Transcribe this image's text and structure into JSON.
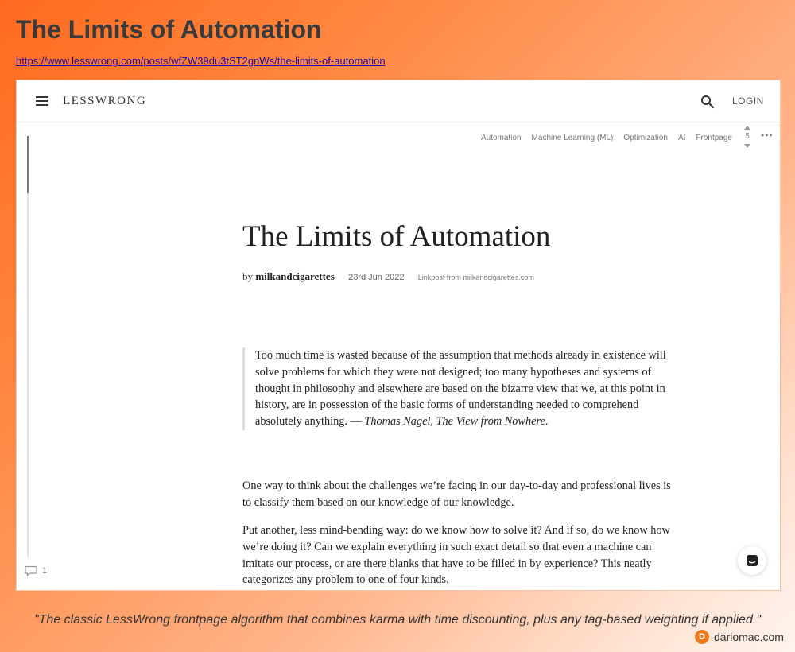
{
  "header": {
    "title": "The Limits of Automation",
    "url": "https://www.lesswrong.com/posts/wfZW39du3tST2gnWs/the-limits-of-automation"
  },
  "site": {
    "logo": "LESSWRONG",
    "login": "LOGIN",
    "icons": {
      "menu": "menu-icon",
      "search": "search-icon",
      "chat": "chat-icon",
      "comment": "comment-icon"
    }
  },
  "post": {
    "tags": [
      "Automation",
      "Machine Learning (ML)",
      "Optimization",
      "AI",
      "Frontpage"
    ],
    "karma": "5",
    "more": "•••",
    "title": "The Limits of Automation",
    "by": "by",
    "author": "milkandcigarettes",
    "date": "23rd Jun 2022",
    "linkpost": "Linkpost from milkandcigarettes.com",
    "quote_text": "Too much time is wasted because of the assumption that methods already in existence will solve problems for which they were not designed; too many hypotheses and systems of thought in philosophy and elsewhere are based on the bizarre view that we, at this point in history, are in possession of the basic forms of understanding needed to comprehend absolutely anything. — ",
    "quote_source": "Thomas Nagel, The View from Nowhere",
    "quote_end": ".",
    "paragraphs": [
      "One way to think about the challenges we’re facing in our day-to-day and professional lives is to classify them based on our knowledge of our knowledge.",
      "Put another, less mind-bending way: do we know how to solve it? And if so, do we know how we’re doing it? Can we explain everything in such exact detail so that even a machine can imitate our process, or are there blanks that have to be filled in by experience? This neatly categorizes any problem to one of four kinds."
    ],
    "comment_count": "1"
  },
  "footer": {
    "caption": "\"The classic LessWrong frontpage algorithm that combines karma with time discounting, plus any tag-based weighting if applied.\"",
    "badge": "D",
    "site": "dariomac.com"
  }
}
